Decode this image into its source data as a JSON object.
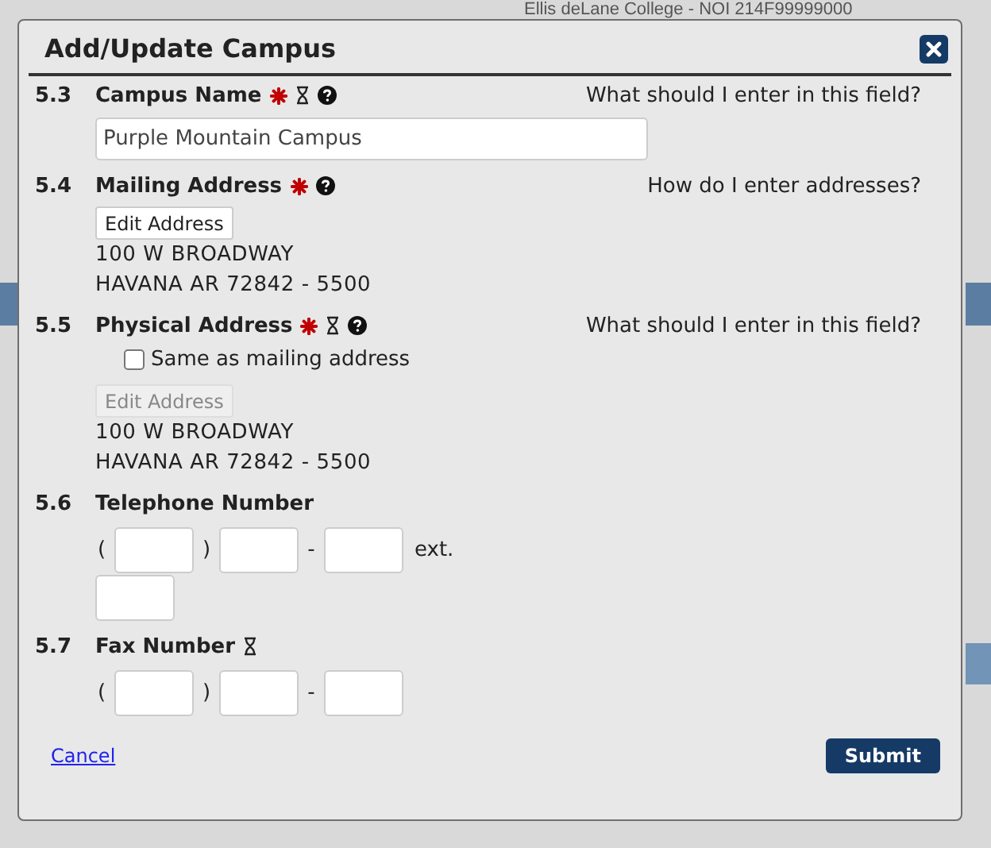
{
  "background": {
    "header": "Ellis deLane College - NOI 214F99999000"
  },
  "dialog": {
    "title": "Add/Update Campus"
  },
  "fields": [
    {
      "number": "5.3",
      "label": "Campus Name",
      "required": true,
      "timed": true,
      "help": true,
      "hint": "What should I enter in this field?",
      "kind": "text",
      "value": "Purple Mountain Campus"
    },
    {
      "number": "5.4",
      "label": "Mailing Address",
      "required": true,
      "timed": false,
      "help": true,
      "hint": "How do I enter addresses?",
      "kind": "address",
      "edit_button": {
        "label": "Edit Address",
        "disabled": false
      },
      "address_lines": [
        "100 W BROADWAY",
        "HAVANA AR 72842 - 5500"
      ]
    },
    {
      "number": "5.5",
      "label": "Physical Address",
      "required": true,
      "timed": true,
      "help": true,
      "hint": "What should I enter in this field?",
      "kind": "address",
      "checkbox": {
        "label": "Same as mailing address",
        "checked": false
      },
      "edit_button": {
        "label": "Edit Address",
        "disabled": true
      },
      "address_lines": [
        "100 W BROADWAY",
        "HAVANA AR 72842 - 5500"
      ]
    },
    {
      "number": "5.6",
      "label": "Telephone Number",
      "required": false,
      "timed": false,
      "help": false,
      "kind": "phone",
      "separators": [
        "(",
        ")",
        "-"
      ],
      "ext_label": "ext."
    },
    {
      "number": "5.7",
      "label": "Fax Number",
      "required": false,
      "timed": true,
      "help": false,
      "kind": "phone",
      "separators": [
        "(",
        ")",
        "-"
      ]
    }
  ],
  "footer": {
    "cancel": "Cancel",
    "submit": "Submit"
  }
}
